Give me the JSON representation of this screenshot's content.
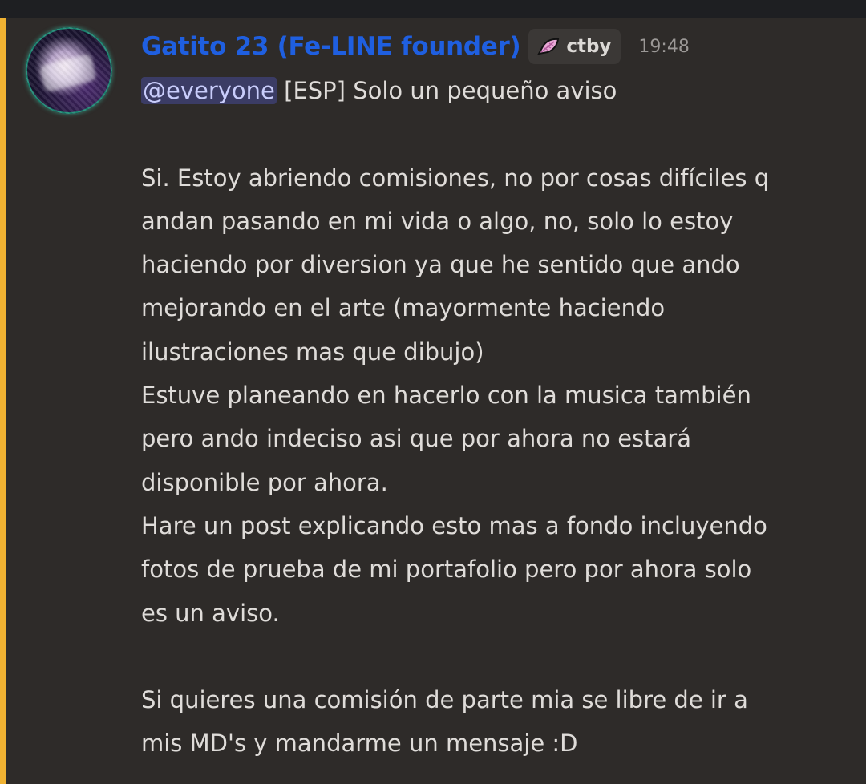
{
  "message": {
    "author": {
      "display_name": "Gatito 23 (Fe-LINE founder)",
      "name_color": "#1f5fe0",
      "avatar_icon": "avatar-image"
    },
    "server_tag": {
      "icon": "pink-feather-icon",
      "label": "ctby"
    },
    "timestamp": "19:48",
    "mention": "@everyone",
    "first_line_rest": " [ESP] Solo un pequeño aviso",
    "lines": [
      "",
      "Si. Estoy abriendo comisiones, no por cosas difíciles q",
      "andan pasando en mi vida o algo, no, solo lo estoy",
      "haciendo por diversion ya que he sentido que ando",
      "mejorando en el arte (mayormente haciendo",
      "ilustraciones mas que dibujo)",
      "Estuve planeando en hacerlo con la musica también",
      "pero ando indeciso asi que por ahora no estará",
      "disponible por ahora.",
      "Hare un post explicando esto mas a fondo incluyendo",
      "fotos de prueba de mi portafolio pero por ahora solo",
      "es un aviso.",
      "",
      "Si quieres una comisión de parte mia se libre de ir a",
      "mis MD's y mandarme un mensaje :D"
    ]
  },
  "colors": {
    "mention_stripe": "#f0b232",
    "background": "#2e2b29",
    "text": "#dfdcd9"
  }
}
